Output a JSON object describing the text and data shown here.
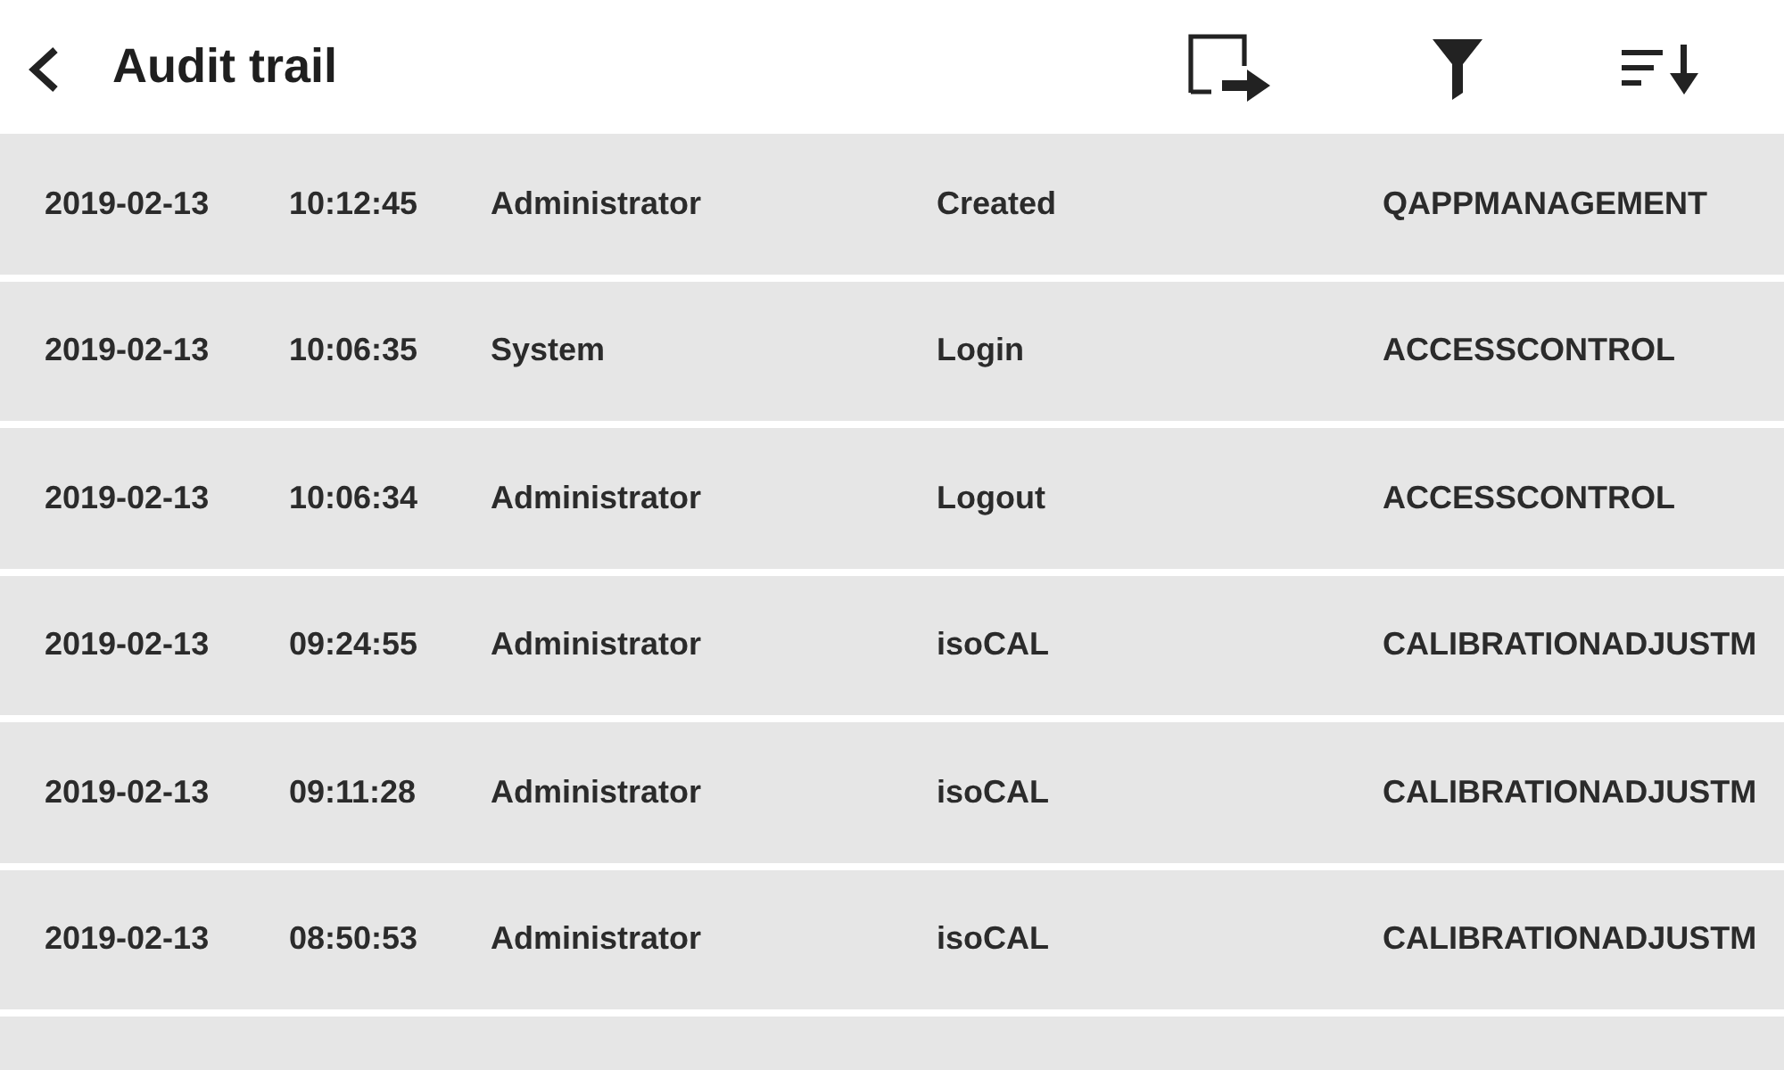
{
  "header": {
    "title": "Audit trail"
  },
  "rows": [
    {
      "date": "2019-02-13",
      "time": "10:12:45",
      "user": "Administrator",
      "action": "Created",
      "module": "QAPPMANAGEMENT"
    },
    {
      "date": "2019-02-13",
      "time": "10:06:35",
      "user": "System",
      "action": "Login",
      "module": "ACCESSCONTROL"
    },
    {
      "date": "2019-02-13",
      "time": "10:06:34",
      "user": "Administrator",
      "action": "Logout",
      "module": "ACCESSCONTROL"
    },
    {
      "date": "2019-02-13",
      "time": "09:24:55",
      "user": "Administrator",
      "action": "isoCAL",
      "module": "CALIBRATIONADJUSTM"
    },
    {
      "date": "2019-02-13",
      "time": "09:11:28",
      "user": "Administrator",
      "action": "isoCAL",
      "module": "CALIBRATIONADJUSTM"
    },
    {
      "date": "2019-02-13",
      "time": "08:50:53",
      "user": "Administrator",
      "action": "isoCAL",
      "module": "CALIBRATIONADJUSTM"
    }
  ]
}
